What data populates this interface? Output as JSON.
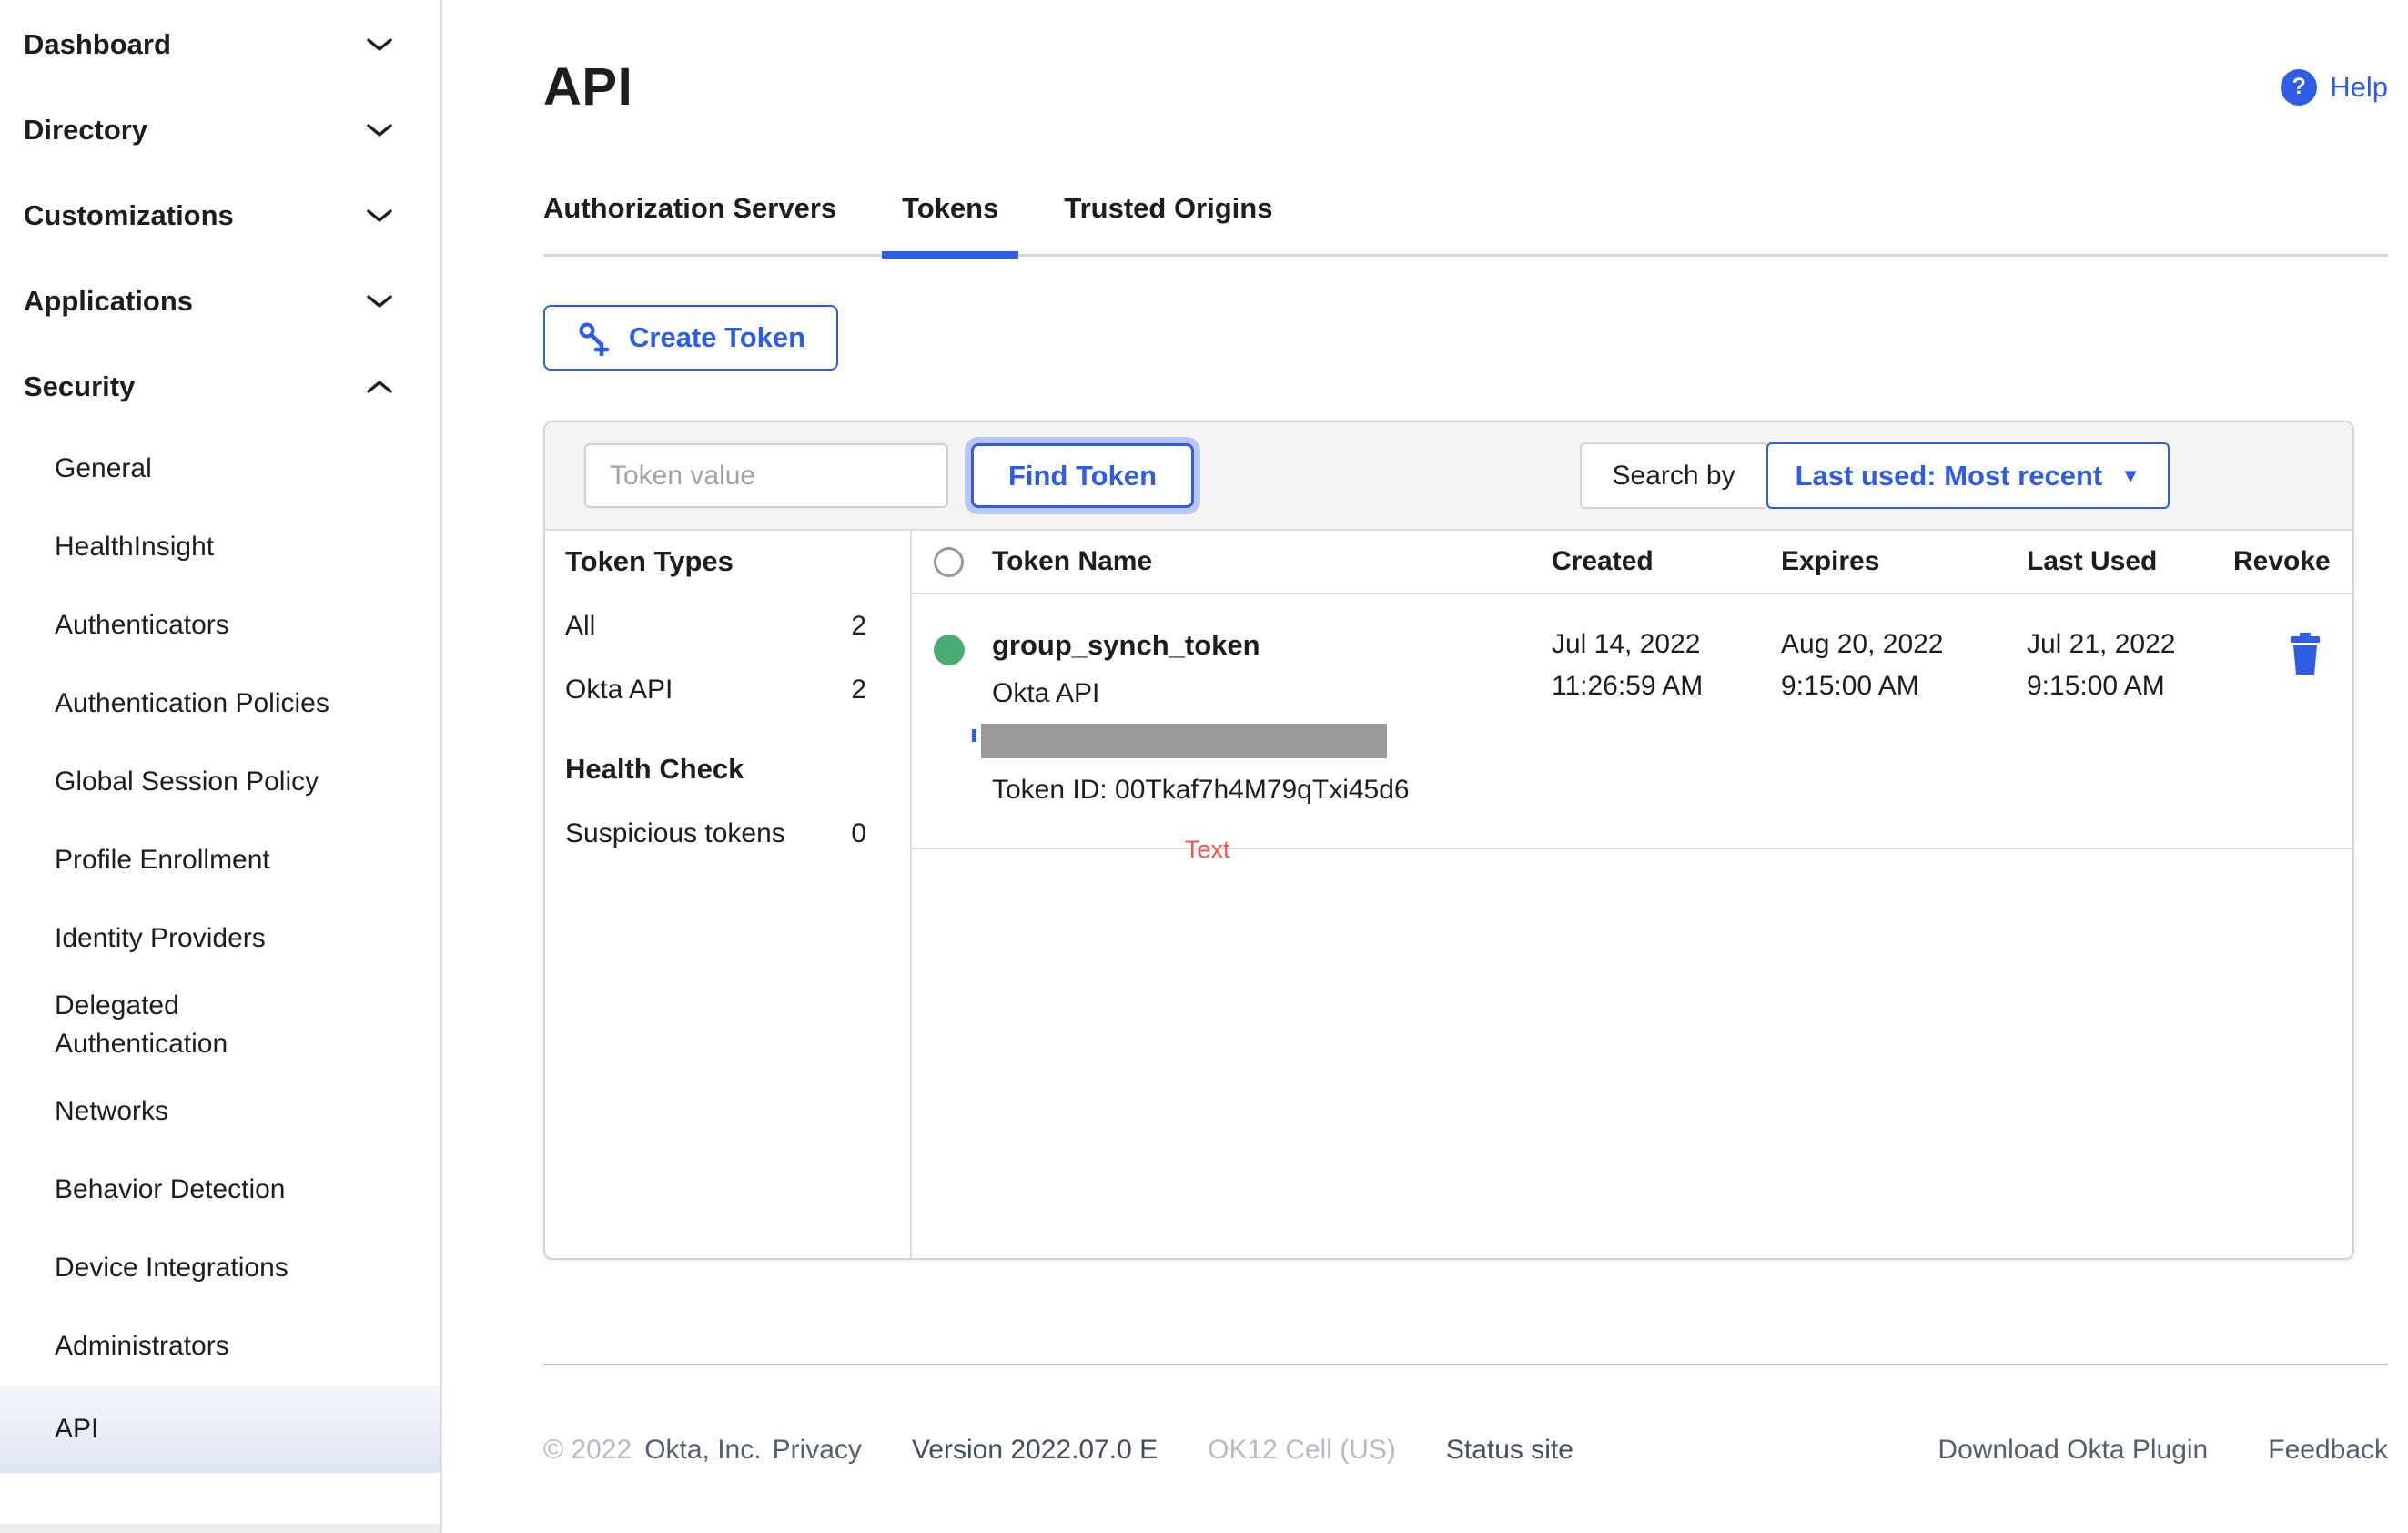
{
  "colors": {
    "accent": "#2E5CE4",
    "status_green": "#4BAB74",
    "annotation_red": "#F05748",
    "selected_item_bg": "#EAEEF9"
  },
  "sidebar": {
    "sections": [
      {
        "label": "Dashboard",
        "chevron": "down"
      },
      {
        "label": "Directory",
        "chevron": "down"
      },
      {
        "label": "Customizations",
        "chevron": "down"
      },
      {
        "label": "Applications",
        "chevron": "down"
      },
      {
        "label": "Security",
        "chevron": "up"
      }
    ],
    "security_items": [
      "General",
      "HealthInsight",
      "Authenticators",
      "Authentication Policies",
      "Global Session Policy",
      "Profile Enrollment",
      "Identity Providers",
      "Delegated Authentication",
      "Networks",
      "Behavior Detection",
      "Device Integrations",
      "Administrators",
      "API"
    ],
    "selected": "API"
  },
  "header": {
    "title": "API",
    "help": "Help",
    "help_icon": "?"
  },
  "tabs": [
    {
      "label": "Authorization Servers"
    },
    {
      "label": "Tokens"
    },
    {
      "label": "Trusted Origins"
    }
  ],
  "active_tab": "Tokens",
  "toolbar": {
    "create_token": "Create Token"
  },
  "search": {
    "placeholder": "Token value",
    "find_button": "Find Token",
    "search_by": "Search by",
    "sort_value": "Last used: Most recent",
    "caret": "▼"
  },
  "filters": {
    "heading": "Token Types",
    "items": [
      {
        "label": "All",
        "count": "2"
      },
      {
        "label": "Okta API",
        "count": "2"
      }
    ],
    "health_heading": "Health Check",
    "health_items": [
      {
        "label": "Suspicious tokens",
        "count": "0"
      }
    ]
  },
  "table": {
    "columns": [
      "Token Name",
      "Created",
      "Expires",
      "Last Used",
      "Revoke"
    ],
    "row": {
      "name": "group_synch_token",
      "type": "Okta API",
      "token_id": "Token ID: 00Tkaf7h4M79qTxi45d6",
      "created_date": "Jul 14, 2022",
      "created_time": "11:26:59 AM",
      "expires_date": "Aug 20, 2022",
      "expires_time": "9:15:00 AM",
      "last_used_date": "Jul 21, 2022",
      "last_used_time": "9:15:00 AM",
      "status": "active"
    }
  },
  "annotation": "Text",
  "footer": {
    "copyright": "© 2022",
    "company": "Okta, Inc.",
    "privacy": "Privacy",
    "version": "Version 2022.07.0 E",
    "cell": "OK12 Cell (US)",
    "status_site": "Status site",
    "download": "Download Okta Plugin",
    "feedback": "Feedback"
  }
}
